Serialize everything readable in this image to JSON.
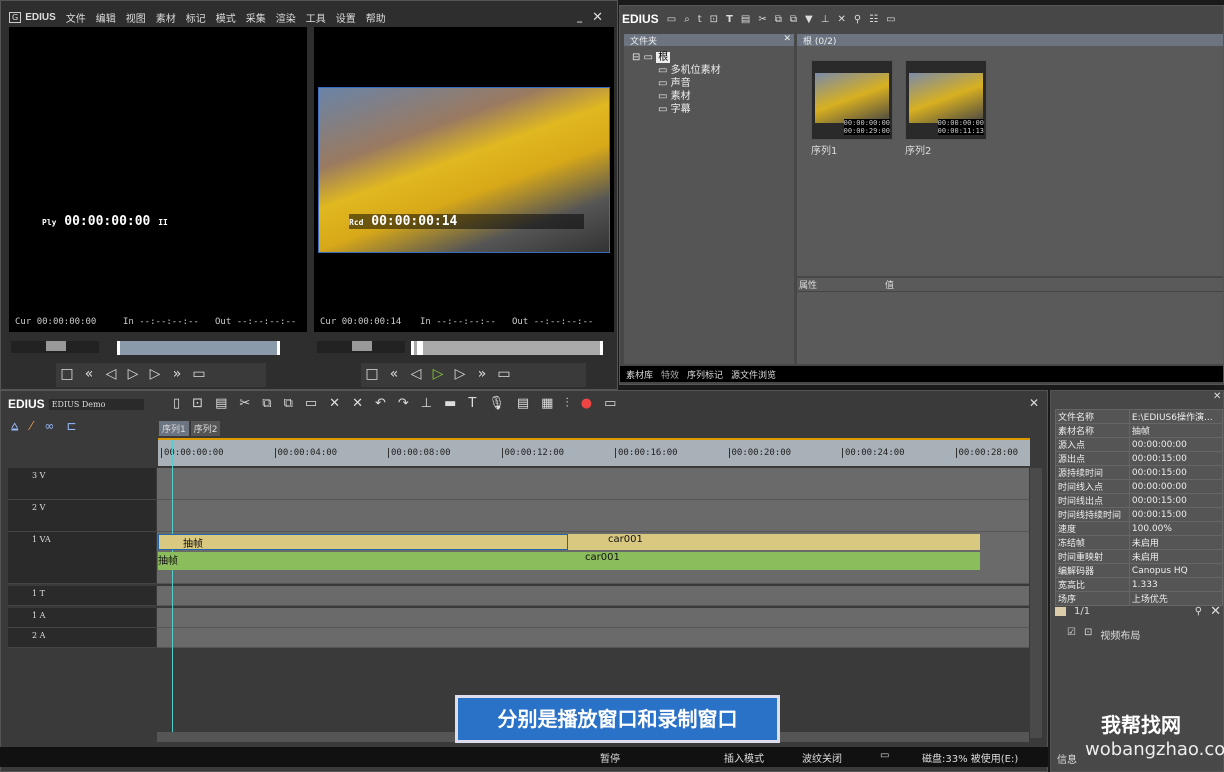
{
  "app": {
    "logo": "EDIUS",
    "menu": [
      "文件",
      "编辑",
      "视图",
      "素材",
      "标记",
      "模式",
      "采集",
      "渲染",
      "工具",
      "设置",
      "帮助"
    ]
  },
  "player": {
    "timecode_label": "Ply",
    "timecode": "00:00:00:00",
    "cur_label": "Cur",
    "cur": "00:00:00:00",
    "in_label": "In",
    "in": "--:--:--:--",
    "out_label": "Out",
    "out": "--:--:--:--"
  },
  "recorder": {
    "timecode_label": "Rcd",
    "timecode": "00:00:00:14",
    "cur_label": "Cur",
    "cur": "00:00:00:14",
    "in_label": "In",
    "in": "--:--:--:--",
    "out_label": "Out",
    "out": "--:--:--:--"
  },
  "bin": {
    "logo": "EDIUS",
    "folder_panel_title": "文件夹",
    "root": "根",
    "folders": [
      "多机位素材",
      "声音",
      "素材",
      "字幕"
    ],
    "content_title": "根 (0/2)",
    "clips": [
      {
        "name": "序列1",
        "tc_in": "00:00:00:00",
        "tc_out": "00:00:29:00"
      },
      {
        "name": "序列2",
        "tc_in": "00:00:00:00",
        "tc_out": "00:00:11:13"
      }
    ],
    "props_header": [
      "属性",
      "值"
    ],
    "tabs": [
      "素材库",
      "特效",
      "序列标记",
      "源文件浏览"
    ]
  },
  "timeline": {
    "logo": "EDIUS",
    "project": "EDIUS Demo",
    "sequences": [
      "序列1",
      "序列2"
    ],
    "ruler": [
      "00:00:00:00",
      "00:00:04:00",
      "00:00:08:00",
      "00:00:12:00",
      "00:00:16:00",
      "00:00:20:00",
      "00:00:24:00",
      "00:00:28:00"
    ],
    "tracks": [
      "3 V",
      "2 V",
      "1 VA",
      "1 T",
      "1 A",
      "2 A"
    ],
    "clips": {
      "video1": "抽帧",
      "video2": "car001",
      "audio1": "抽帧",
      "audio2": "car001"
    }
  },
  "subtitle": "分别是播放窗口和录制窗口",
  "status": {
    "pause": "暂停",
    "insert_mode": "插入模式",
    "ripple": "波纹关闭",
    "disk": "磁盘:33% 被使用(E:)"
  },
  "info_panel": {
    "rows": [
      [
        "文件名称",
        "E:\\EDIUS6操作演..."
      ],
      [
        "素材名称",
        "抽帧"
      ],
      [
        "源入点",
        "00:00:00:00"
      ],
      [
        "源出点",
        "00:00:15:00"
      ],
      [
        "源持续时间",
        "00:00:15:00"
      ],
      [
        "时间线入点",
        "00:00:00:00"
      ],
      [
        "时间线出点",
        "00:00:15:00"
      ],
      [
        "时间线持续时间",
        "00:00:15:00"
      ],
      [
        "速度",
        "100.00%"
      ],
      [
        "冻结帧",
        "未启用"
      ],
      [
        "时间重映射",
        "未启用"
      ],
      [
        "编解码器",
        "Canopus HQ"
      ],
      [
        "宽高比",
        "1.333"
      ],
      [
        "场序",
        "上场优先"
      ]
    ],
    "effects_count": "1/1",
    "effect": "视频布局",
    "footer": "信息"
  },
  "watermark": "wobangzhao.com",
  "watermark_cn": "我帮找网"
}
